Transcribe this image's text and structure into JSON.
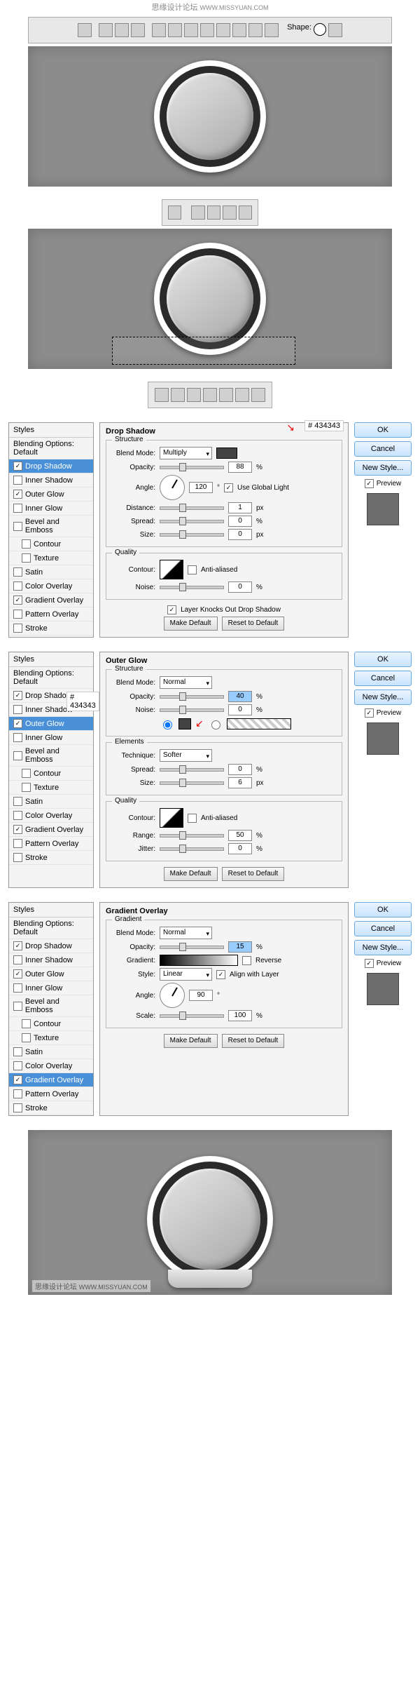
{
  "watermark": "思缘设计论坛",
  "watermark_url": "WWW.MISSYUAN.COM",
  "toolbars": {
    "shape_label": "Shape:"
  },
  "styles_labels": {
    "header": "Styles",
    "blending": "Blending Options: Default",
    "drop_shadow": "Drop Shadow",
    "inner_shadow": "Inner Shadow",
    "outer_glow": "Outer Glow",
    "inner_glow": "Inner Glow",
    "bevel": "Bevel and Emboss",
    "contour": "Contour",
    "texture": "Texture",
    "satin": "Satin",
    "color_overlay": "Color Overlay",
    "gradient_overlay": "Gradient Overlay",
    "pattern_overlay": "Pattern Overlay",
    "stroke": "Stroke"
  },
  "buttons": {
    "ok": "OK",
    "cancel": "Cancel",
    "new_style": "New Style...",
    "preview": "Preview",
    "make_default": "Make Default",
    "reset_default": "Reset to Default"
  },
  "drop_shadow_panel": {
    "title": "Drop Shadow",
    "hex": "434343",
    "group_structure": "Structure",
    "blend_mode_lbl": "Blend Mode:",
    "blend_mode": "Multiply",
    "opacity_lbl": "Opacity:",
    "opacity": "88",
    "angle_lbl": "Angle:",
    "angle": "120",
    "use_global": "Use Global Light",
    "distance_lbl": "Distance:",
    "distance": "1",
    "spread_lbl": "Spread:",
    "spread": "0",
    "size_lbl": "Size:",
    "size": "0",
    "group_quality": "Quality",
    "contour_lbl": "Contour:",
    "anti": "Anti-aliased",
    "noise_lbl": "Noise:",
    "noise": "0",
    "knockout": "Layer Knocks Out Drop Shadow",
    "unit_pct": "%",
    "unit_px": "px",
    "unit_deg": "°"
  },
  "outer_glow_panel": {
    "title": "Outer Glow",
    "hex": "434343",
    "group_structure": "Structure",
    "blend_mode_lbl": "Blend Mode:",
    "blend_mode": "Normal",
    "opacity_lbl": "Opacity:",
    "opacity": "40",
    "noise_lbl": "Noise:",
    "noise": "0",
    "group_elements": "Elements",
    "technique_lbl": "Technique:",
    "technique": "Softer",
    "spread_lbl": "Spread:",
    "spread": "0",
    "size_lbl": "Size:",
    "size": "6",
    "group_quality": "Quality",
    "contour_lbl": "Contour:",
    "anti": "Anti-aliased",
    "range_lbl": "Range:",
    "range": "50",
    "jitter_lbl": "Jitter:",
    "jitter": "0",
    "unit_pct": "%",
    "unit_px": "px"
  },
  "gradient_overlay_panel": {
    "title": "Gradient Overlay",
    "group_gradient": "Gradient",
    "blend_mode_lbl": "Blend Mode:",
    "blend_mode": "Normal",
    "opacity_lbl": "Opacity:",
    "opacity": "15",
    "gradient_lbl": "Gradient:",
    "reverse": "Reverse",
    "style_lbl": "Style:",
    "style": "Linear",
    "align": "Align with Layer",
    "angle_lbl": "Angle:",
    "angle": "90",
    "scale_lbl": "Scale:",
    "scale": "100",
    "unit_pct": "%",
    "unit_deg": "°"
  }
}
